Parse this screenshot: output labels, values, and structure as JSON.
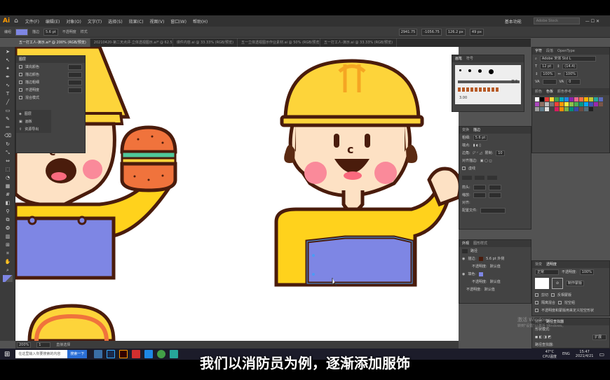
{
  "app": {
    "logo": "Ai",
    "menu": [
      "文件(F)",
      "编辑(E)",
      "对象(O)",
      "文字(T)",
      "选择(S)",
      "效果(C)",
      "视图(V)",
      "窗口(W)",
      "帮助(H)"
    ],
    "workspace": "基本功能",
    "search_placeholder": "Adobe Stock"
  },
  "control_bar": {
    "path_label": "编组",
    "stroke_label": "描边",
    "opacity_label": "不透明度",
    "style_label": "样式",
    "stroke_value": "5.6 pt",
    "x_value": "2941.75",
    "y_value": "-1056.75",
    "w_value": "126.2 px",
    "h_value": "49 px"
  },
  "tabs": [
    {
      "label": "五一打工人-演示.ai* @ 200% (RGB/预览)"
    },
    {
      "label": "20210420-第二天点评-立体透视图示.ai* @ 62.5% (RGB/预览)"
    },
    {
      "label": "课件内容.ai @ 33.33% (RGB/预览)"
    },
    {
      "label": "五一立体透视图示作业素材.ai @ 50% (RGB/预览)"
    },
    {
      "label": "五一打工人-演示.ai @ 33.33% (RGB/预览)"
    }
  ],
  "appearance_mini_panel": {
    "title": "图层",
    "rows": [
      "填充颜色",
      "描边颜色",
      "描边粗细",
      "不透明度",
      "混合模式"
    ],
    "row_values": [
      "",
      "",
      "",
      "",
      ""
    ],
    "menu_items": [
      "图层",
      "画板",
      "资源导出"
    ]
  },
  "brushes_panel": {
    "tabs": [
      "画笔",
      "符号"
    ],
    "stroke_value": "3.00",
    "basic_label": "基本"
  },
  "stroke_panel": {
    "tabs": [
      "变换",
      "描边"
    ],
    "weight_label": "粗细:",
    "weight_value": "5.6 pt",
    "cap_label": "端点:",
    "corner_label": "边角:",
    "limit_label": "限制:",
    "limit_value": "10",
    "align_label": "对齐描边:",
    "dashed_label": "虚线",
    "arrow_label": "箭头:",
    "scale_label": "缩放:",
    "align2_label": "对齐:",
    "profile_label": "配置文件:"
  },
  "appearance_panel": {
    "tabs": [
      "外观",
      "图形样式"
    ],
    "header": "路径",
    "rows": [
      {
        "label": "描边:",
        "value": "5.6 pt  外侧"
      },
      {
        "label": "不透明度:",
        "value": "默认值"
      },
      {
        "label": "填色:",
        "value": ""
      },
      {
        "label": "不透明度:",
        "value": "默认值"
      },
      {
        "label": "不透明度:",
        "value": "默认值"
      }
    ]
  },
  "color_panel": {
    "tabs": [
      "字符",
      "段落",
      "OpenType"
    ],
    "font": "Adobe 宋体 Std L",
    "size": "12 pt",
    "leading": "(14.4)",
    "scale1": "100%",
    "scale2": "100%",
    "track": "0",
    "swatch_tabs": [
      "颜色",
      "色板",
      "颜色参考"
    ]
  },
  "transparency_panel": {
    "tabs": [
      "渐变",
      "透明度"
    ],
    "mode": "正常",
    "opacity_label": "不透明度:",
    "opacity_value": "100%",
    "make_mask": "制作蒙版",
    "clip": "剪切",
    "invert": "反相蒙版",
    "isolate": "隔离混合",
    "knockout": "挖空组",
    "define": "不透明度和蒙版用来定义挖空形状"
  },
  "pathfinder_panel": {
    "tabs": [
      "对齐",
      "路径查找器"
    ],
    "shape_modes": "形状模式:",
    "pathfinders": "路径查找器:",
    "expand": "扩展"
  },
  "status": {
    "zoom": "200%",
    "page": "1",
    "tool": "直接选择"
  },
  "watermark": {
    "line1": "激活 Windows",
    "line2": "转到\"设置\"以激活 Windows。"
  },
  "taskbar": {
    "search_placeholder": "在这里输入你要搜索的内容",
    "search_button": "搜索一下",
    "temp": "47°C",
    "cpu": "CPU温度",
    "lang": "ENG",
    "time": "15:47",
    "date": "2021/4/21"
  },
  "subtitle": "我们以消防员为例，逐渐添加服饰",
  "colors": {
    "helmet": "#fdd43a",
    "skin": "#fde1c4",
    "outline": "#4a1c0c",
    "overalls": "#7e86e4",
    "cheek": "#fa6a7e",
    "burger_bun": "#f0733c"
  }
}
